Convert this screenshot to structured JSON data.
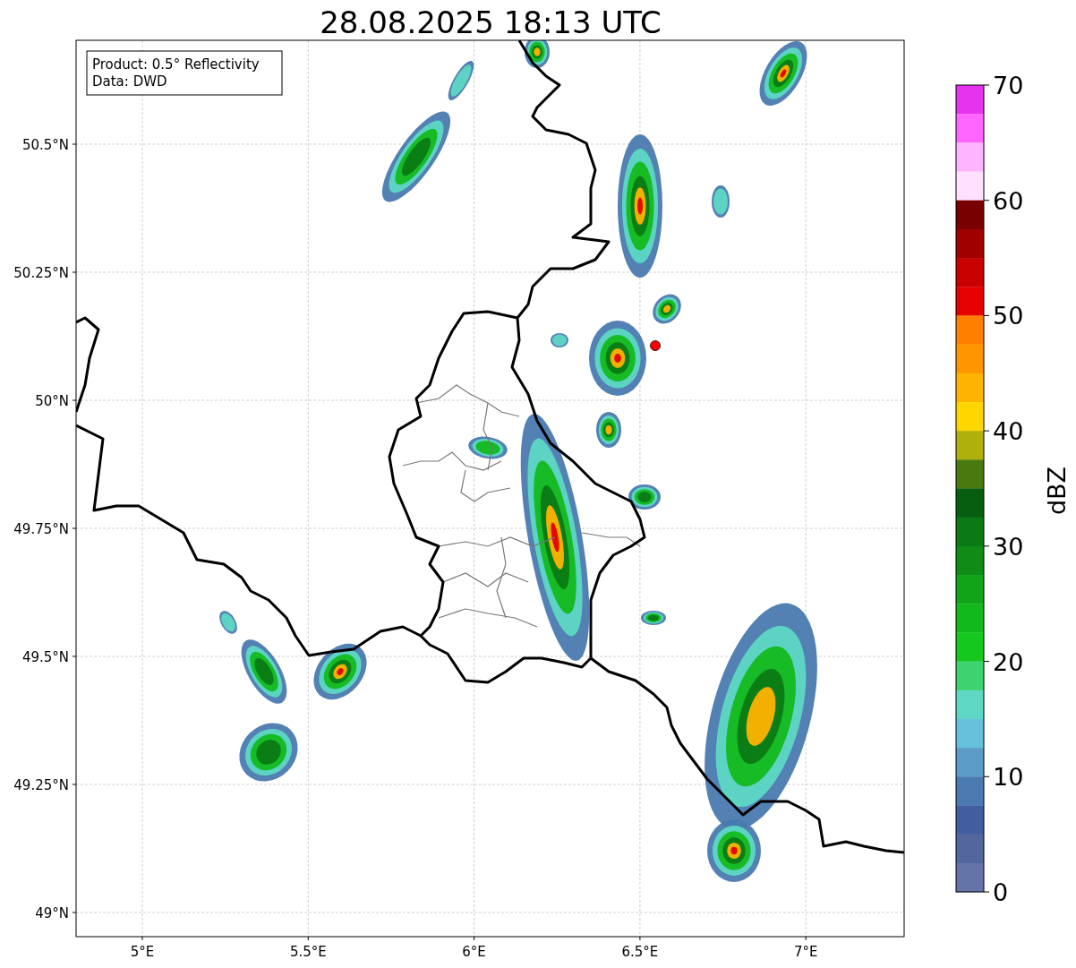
{
  "title": "28.08.2025 18:13 UTC",
  "map": {
    "info_lines": [
      "Product: 0.5° Reflectivity",
      "Data: DWD"
    ],
    "x_ticks": [
      "5°E",
      "5.5°E",
      "6°E",
      "6.5°E",
      "7°E"
    ],
    "y_ticks": [
      "50.5°N",
      "50.25°N",
      "50°N",
      "49.75°N",
      "49.5°N",
      "49.25°N",
      "49°N"
    ]
  },
  "colorbar": {
    "label": "dBZ",
    "ticks": [
      "70",
      "60",
      "50",
      "40",
      "30",
      "20",
      "10",
      "0"
    ],
    "bands": [
      {
        "color": "#e633ee"
      },
      {
        "color": "#ff66ff"
      },
      {
        "color": "#ffb4ff"
      },
      {
        "color": "#ffe0ff"
      },
      {
        "color": "#780000"
      },
      {
        "color": "#a00000"
      },
      {
        "color": "#c80000"
      },
      {
        "color": "#e60000"
      },
      {
        "color": "#ff7f00"
      },
      {
        "color": "#ff9600"
      },
      {
        "color": "#ffb400"
      },
      {
        "color": "#ffd700"
      },
      {
        "color": "#b0b00a"
      },
      {
        "color": "#4a7a0e"
      },
      {
        "color": "#085e10"
      },
      {
        "color": "#0a7a14"
      },
      {
        "color": "#0e8c16"
      },
      {
        "color": "#10a518"
      },
      {
        "color": "#12b91c"
      },
      {
        "color": "#14c81e"
      },
      {
        "color": "#3cd46e"
      },
      {
        "color": "#5ed8c4"
      },
      {
        "color": "#66c2dc"
      },
      {
        "color": "#5b9bc8"
      },
      {
        "color": "#4a7ab0"
      },
      {
        "color": "#435ea0"
      },
      {
        "color": "#53669e"
      },
      {
        "color": "#6474a8"
      }
    ]
  }
}
